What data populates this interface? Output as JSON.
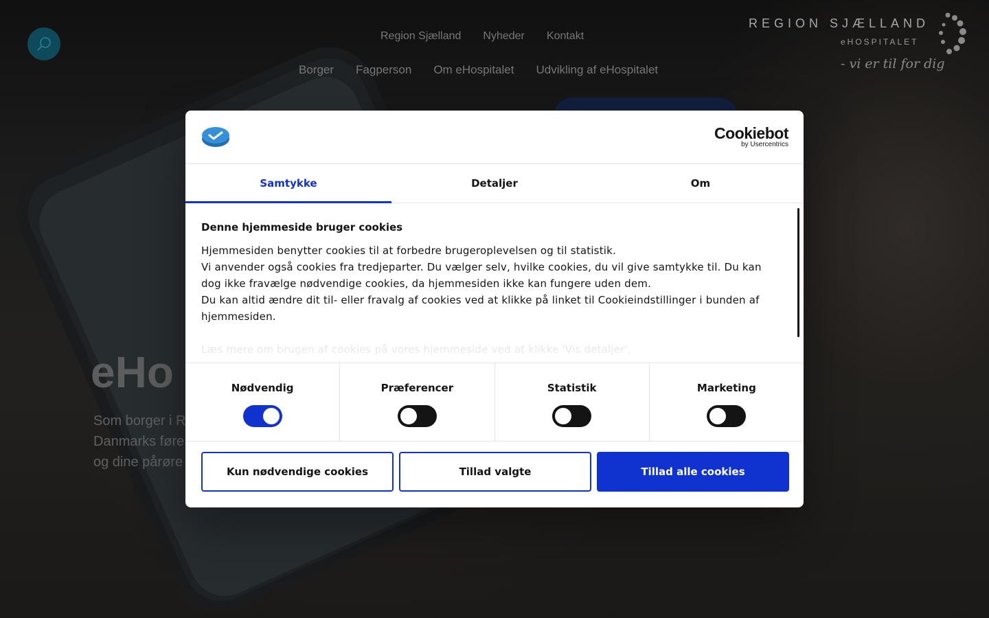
{
  "header": {
    "top_nav": [
      "Region Sjælland",
      "Nyheder",
      "Kontakt"
    ],
    "main_nav": [
      "Borger",
      "Fagperson",
      "Om eHospitalet",
      "Udvikling af eHospitalet"
    ],
    "logo": {
      "title": "REGION SJÆLLAND",
      "subtitle": "eHOSPITALET",
      "tagline": "- vi er til for dig"
    },
    "search_icon": "search-icon"
  },
  "hero": {
    "title": "eHo",
    "lead": [
      "Som borger i R",
      "Danmarks føre",
      "og dine pårøre"
    ]
  },
  "cookie_dialog": {
    "brand": {
      "name": "Cookiebot",
      "by": "by Usercentrics"
    },
    "tabs": [
      {
        "label": "Samtykke",
        "active": true
      },
      {
        "label": "Detaljer",
        "active": false
      },
      {
        "label": "Om",
        "active": false
      }
    ],
    "heading": "Denne hjemmeside bruger cookies",
    "paragraphs": [
      "Hjemmesiden benytter cookies til at forbedre brugeroplevelsen og til statistik.",
      "Vi anvender også cookies fra tredjeparter. Du vælger selv, hvilke cookies, du vil give samtykke til. Du kan dog ikke fravælge nødvendige cookies, da hjemmesiden ikke kan fungere uden dem.",
      "Du kan altid ændre dit til- eller fravalg af cookies ved at klikke på linket til Cookieindstillinger i bunden af hjemmesiden."
    ],
    "more_info": "Læs mere om brugen af cookies på vores hjemmeside ved at klikke 'Vis detaljer'.",
    "toggles": [
      {
        "label": "Nødvendig",
        "on": true
      },
      {
        "label": "Præferencer",
        "on": false
      },
      {
        "label": "Statistik",
        "on": false
      },
      {
        "label": "Marketing",
        "on": false
      }
    ],
    "buttons": {
      "necessary": "Kun nødvendige cookies",
      "selected": "Tillad valgte",
      "all": "Tillad alle cookies"
    },
    "colors": {
      "accent": "#1032cf",
      "text": "#141414"
    }
  }
}
